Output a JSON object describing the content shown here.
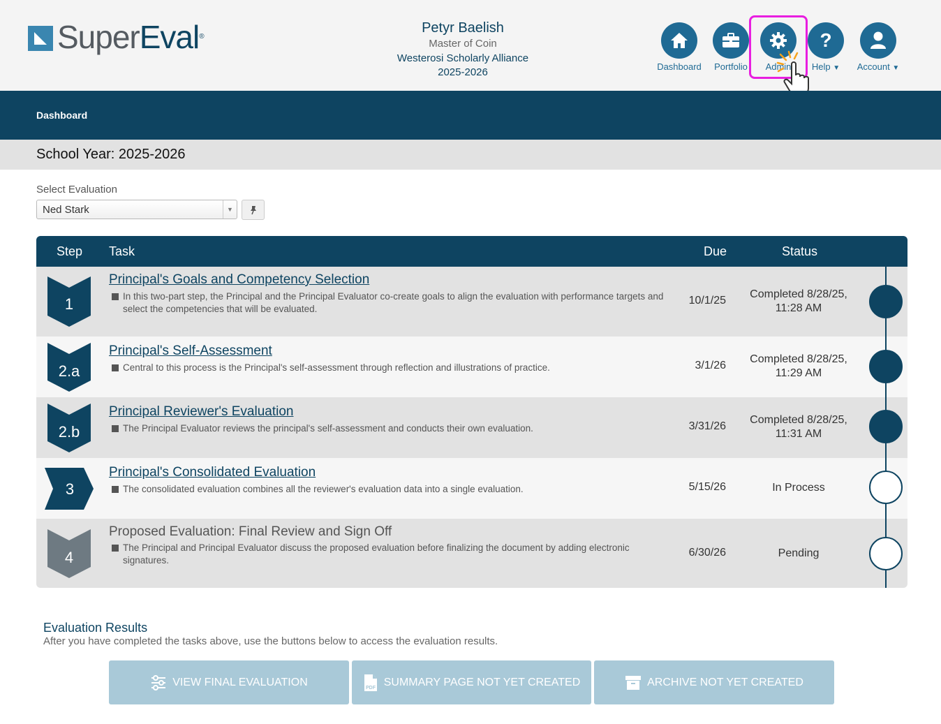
{
  "brand": {
    "logo_super": "Super",
    "logo_eval": "Eval",
    "logo_reg": "®"
  },
  "user": {
    "name": "Petyr Baelish",
    "role": "Master of Coin",
    "org": "Westerosi Scholarly Alliance",
    "year": "2025-2026"
  },
  "nav": {
    "dashboard": "Dashboard",
    "portfolio": "Portfolio",
    "admin": "Admin",
    "help": "Help",
    "account": "Account"
  },
  "breadcrumb": "Dashboard",
  "school_year": "School Year: 2025-2026",
  "evaluation": {
    "label": "Select Evaluation",
    "selected": "Ned Stark"
  },
  "table": {
    "headers": {
      "step": "Step",
      "task": "Task",
      "due": "Due",
      "status": "Status"
    },
    "rows": [
      {
        "step": "1",
        "title": "Principal's Goals and Competency Selection",
        "desc": "In this two-part step, the Principal and the Principal Evaluator co-create goals to align the evaluation with performance targets and select the competencies that will be evaluated.",
        "due": "10/1/25",
        "status": "Completed 8/28/25, 11:28 AM",
        "state": "done"
      },
      {
        "step": "2.a",
        "title": "Principal's Self-Assessment",
        "desc": "Central to this process is the Principal's self-assessment through reflection and illustrations of practice.",
        "due": "3/1/26",
        "status": "Completed 8/28/25, 11:29 AM",
        "state": "done"
      },
      {
        "step": "2.b",
        "title": "Principal Reviewer's Evaluation",
        "desc": "The Principal Evaluator reviews the principal's self-assessment and conducts their own evaluation.",
        "due": "3/31/26",
        "status": "Completed 8/28/25, 11:31 AM",
        "state": "done"
      },
      {
        "step": "3",
        "title": "Principal's Consolidated Evaluation",
        "desc": "The consolidated evaluation combines all the reviewer's evaluation data into a single evaluation.",
        "due": "5/15/26",
        "status": "In Process",
        "state": "current"
      },
      {
        "step": "4",
        "title": "Proposed Evaluation: Final Review and Sign Off",
        "desc": "The Principal and Principal Evaluator discuss the proposed evaluation before finalizing the document by adding electronic signatures.",
        "due": "6/30/26",
        "status": "Pending",
        "state": "pending"
      }
    ]
  },
  "results": {
    "title": "Evaluation Results",
    "desc": "After you have completed the tasks above, use the buttons below to access the evaluation results.",
    "buttons": {
      "final": "VIEW FINAL EVALUATION",
      "summary": "SUMMARY PAGE NOT YET CREATED",
      "archive": "ARCHIVE NOT YET CREATED"
    }
  },
  "colors": {
    "navy": "#0e4461",
    "nav_blue": "#1f6a94",
    "highlight": "#e81ee0",
    "pending_gray": "#6e7a82",
    "button_disabled": "#a9c9d8"
  },
  "icons": [
    "home-icon",
    "briefcase-icon",
    "gear-icon",
    "question-icon",
    "user-icon",
    "pin-icon",
    "sliders-icon",
    "pdf-icon",
    "archive-icon",
    "hand-pointer-icon"
  ]
}
